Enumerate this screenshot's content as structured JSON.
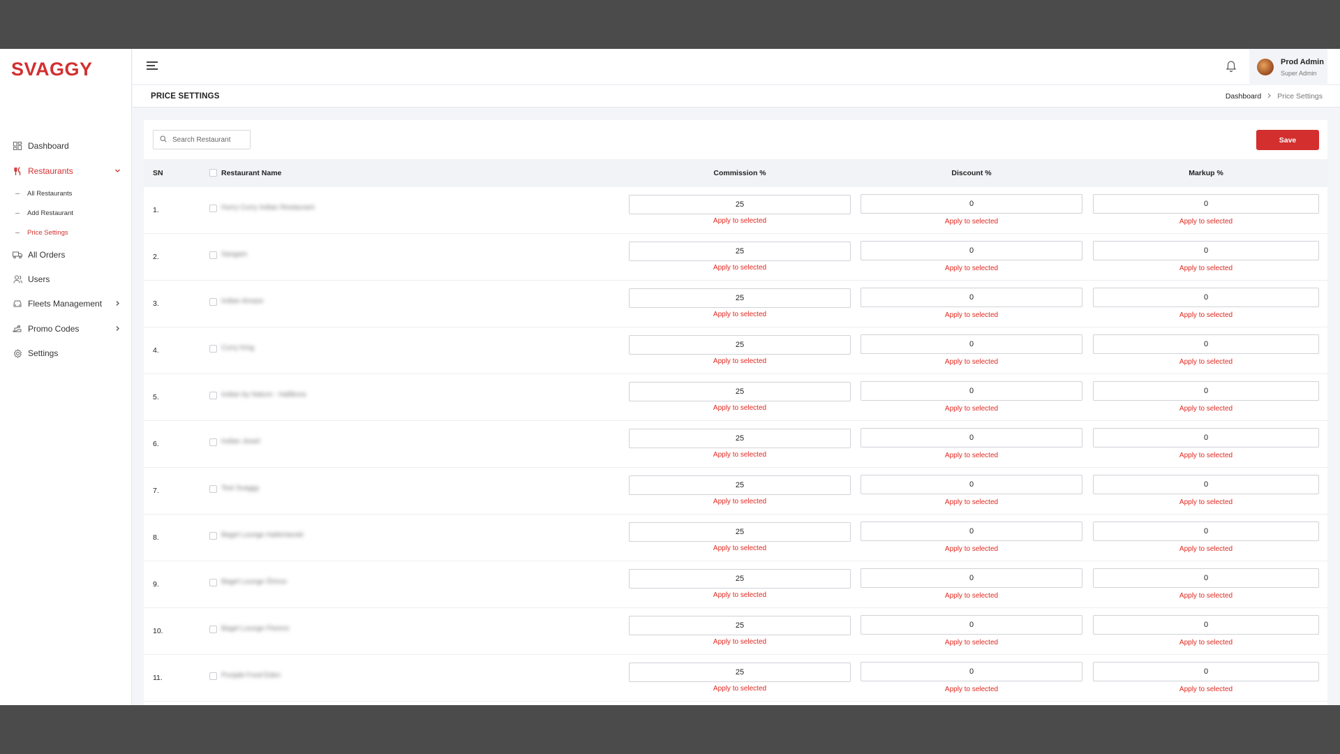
{
  "brand": {
    "logo": "SVAGGY",
    "accent": "#d32f2f"
  },
  "sidebar": {
    "items": [
      {
        "label": "Dashboard",
        "icon": "dashboard-icon"
      },
      {
        "label": "Restaurants",
        "icon": "restaurant-icon",
        "active": true,
        "expanded": true,
        "children": [
          {
            "label": "All Restaurants"
          },
          {
            "label": "Add Restaurant"
          },
          {
            "label": "Price Settings",
            "active": true
          }
        ]
      },
      {
        "label": "All Orders",
        "icon": "truck-icon"
      },
      {
        "label": "Users",
        "icon": "users-icon"
      },
      {
        "label": "Fleets Management",
        "icon": "car-icon",
        "has_submenu": true
      },
      {
        "label": "Promo Codes",
        "icon": "promo-icon",
        "has_submenu": true
      },
      {
        "label": "Settings",
        "icon": "gear-icon"
      }
    ]
  },
  "header": {
    "user": {
      "name": "Prod Admin",
      "role": "Super Admin"
    }
  },
  "page": {
    "title": "PRICE SETTINGS",
    "breadcrumb": {
      "home": "Dashboard",
      "current": "Price Settings"
    }
  },
  "toolbar": {
    "search_placeholder": "Search Restaurant",
    "save_label": "Save"
  },
  "table": {
    "columns": {
      "sn": "SN",
      "name": "Restaurant Name",
      "commission": "Commission %",
      "discount": "Discount %",
      "markup": "Markup %"
    },
    "apply_label": "Apply to selected",
    "rows": [
      {
        "sn": "1.",
        "name": "Hurry Curry Indian Restaurant",
        "commission": "25",
        "discount": "0",
        "markup": "0"
      },
      {
        "sn": "2.",
        "name": "Sangam",
        "commission": "25",
        "discount": "0",
        "markup": "0"
      },
      {
        "sn": "3.",
        "name": "Indian Amaze",
        "commission": "25",
        "discount": "0",
        "markup": "0"
      },
      {
        "sn": "4.",
        "name": "Curry King",
        "commission": "25",
        "discount": "0",
        "markup": "0"
      },
      {
        "sn": "5.",
        "name": "Indian by Nature - Hallikora",
        "commission": "25",
        "discount": "0",
        "markup": "0"
      },
      {
        "sn": "6.",
        "name": "Indian Jewel",
        "commission": "25",
        "discount": "0",
        "markup": "0"
      },
      {
        "sn": "7.",
        "name": "Test Svaggy",
        "commission": "25",
        "discount": "0",
        "markup": "0"
      },
      {
        "sn": "8.",
        "name": "Bagel Lounge Hattertanski",
        "commission": "25",
        "discount": "0",
        "markup": "0"
      },
      {
        "sn": "9.",
        "name": "Bagel Lounge Őrince",
        "commission": "25",
        "discount": "0",
        "markup": "0"
      },
      {
        "sn": "10.",
        "name": "Bagel Lounge Florenc",
        "commission": "25",
        "discount": "0",
        "markup": "0"
      },
      {
        "sn": "11.",
        "name": "Punjabi Food Eden",
        "commission": "25",
        "discount": "0",
        "markup": "0"
      }
    ]
  }
}
